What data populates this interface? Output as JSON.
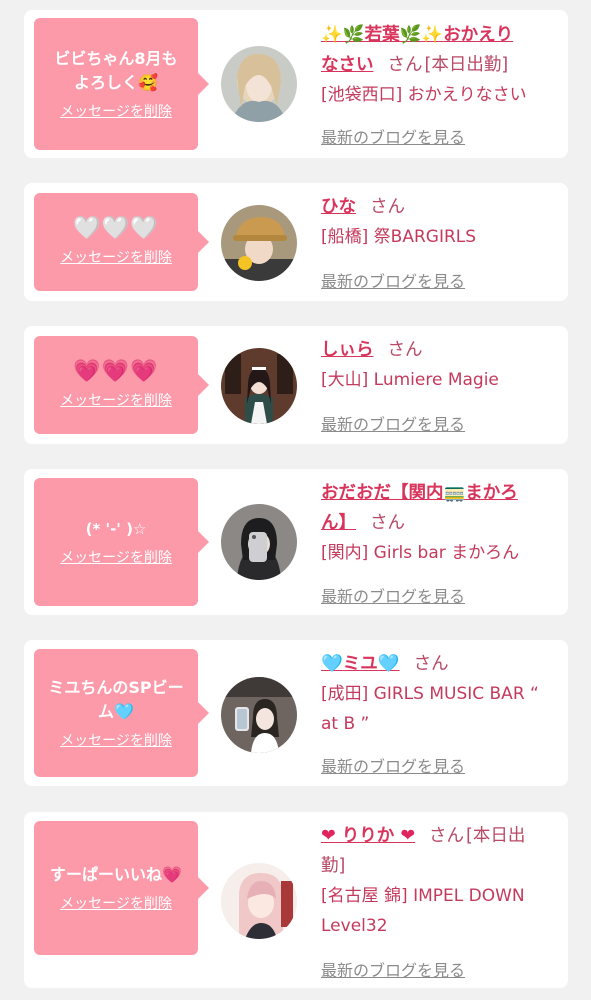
{
  "delete_label": "メッセージを削除",
  "blog_label": "最新のブログを見る",
  "honorific": "さん",
  "messages": [
    {
      "message": "ビビちゃん8月も\nよろしく🥰",
      "name": "✨🌿若葉🌿✨おかえりなさい",
      "suffix": "[本日出勤]",
      "shop": "[池袋西口] おかえりなさい",
      "avatar_icon": "avatar-photo-blonde"
    },
    {
      "message": "🤍🤍🤍",
      "name": "ひな",
      "suffix": "",
      "shop": "[船橋] 祭BARGIRLS",
      "avatar_icon": "avatar-photo-hat"
    },
    {
      "message": "💗💗💗",
      "name": "しぃら",
      "suffix": "",
      "shop": "[大山] Lumiere Magie",
      "avatar_icon": "avatar-photo-maid"
    },
    {
      "message": "(* '-' )☆",
      "name": "おだおだ【関内🚃まかろん】",
      "suffix": "",
      "shop": "[関内] Girls bar まかろん",
      "avatar_icon": "avatar-photo-mirror"
    },
    {
      "message": "ミユちんのSPビー\nム🩵",
      "name": "🩵ミユ🩵",
      "suffix": "",
      "shop": "[成田] GIRLS MUSIC BAR “ at B ”",
      "avatar_icon": "avatar-photo-selfie"
    },
    {
      "message": "すーぱーいいね💗",
      "name": "❤ りりか ❤",
      "suffix": "[本日出勤]",
      "shop": "[名古屋 錦] IMPEL DOWN Level32",
      "avatar_icon": "avatar-photo-pink"
    }
  ]
}
